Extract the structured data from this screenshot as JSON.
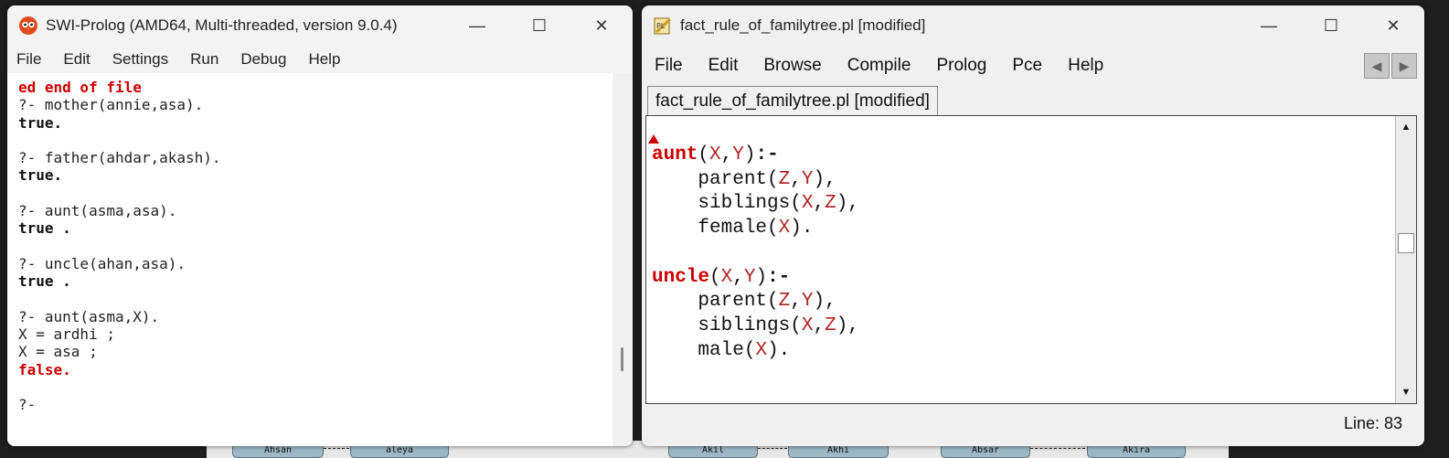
{
  "background": {
    "nodes": [
      "Ahsan",
      "aleya",
      "Akil",
      "Akhi",
      "Absar",
      "Akira"
    ]
  },
  "left_window": {
    "title": "SWI-Prolog (AMD64, Multi-threaded, version 9.0.4)",
    "menu": [
      "File",
      "Edit",
      "Settings",
      "Run",
      "Debug",
      "Help"
    ],
    "console": {
      "first_line": "ed end of file",
      "q1": "?- mother(annie,asa).",
      "r1": "true.",
      "q2": "?- father(ahdar,akash).",
      "r2": "true.",
      "q3": "?- aunt(asma,asa).",
      "r3": "true .",
      "q4": "?- uncle(ahan,asa).",
      "r4": "true .",
      "q5": "?- aunt(asma,X).",
      "a5_1": "X = ardhi ;",
      "a5_2": "X = asa ;",
      "r5": "false.",
      "prompt": "?-"
    }
  },
  "right_window": {
    "title": "fact_rule_of_familytree.pl [modified]",
    "menu": [
      "File",
      "Edit",
      "Browse",
      "Compile",
      "Prolog",
      "Pce",
      "Help"
    ],
    "tab_label": "fact_rule_of_familytree.pl [modified]",
    "code": {
      "aunt_head": "aunt",
      "uncle_head": "uncle",
      "parent": "parent",
      "siblings": "siblings",
      "female": "female",
      "male": "male",
      "var_x": "X",
      "var_y": "Y",
      "var_z": "Z"
    },
    "status_line": "Line: 83"
  },
  "colors": {
    "keyword": "#cc0000",
    "variable": "#b22222",
    "error": "#cc0000"
  },
  "icons": {
    "minimize": "minimize-icon",
    "maximize": "maximize-icon",
    "close": "close-icon"
  }
}
